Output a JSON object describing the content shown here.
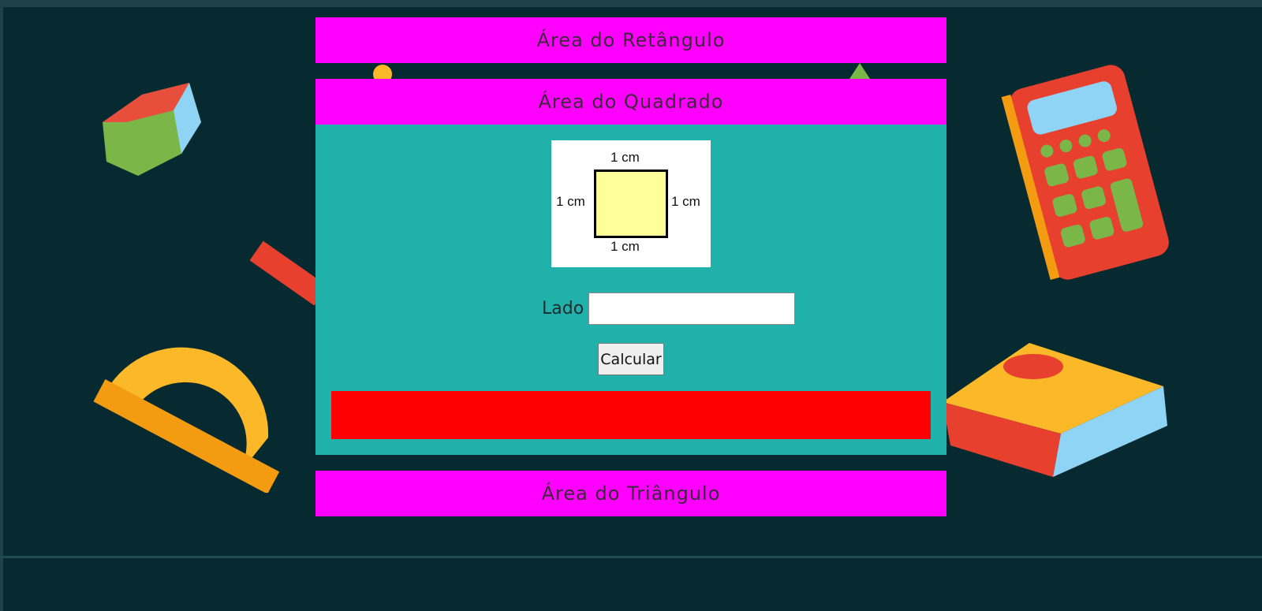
{
  "colors": {
    "background": "#062a30",
    "header_magenta": "#ff00ff",
    "panel_teal": "#20b1aa",
    "result_red": "#ff0000",
    "square_fill": "#ffff99"
  },
  "background_decorations": [
    "cube-icon",
    "calculator-icon",
    "ruler-icon",
    "protractor-icon",
    "book-icon",
    "pencil-icon",
    "set-square-icon"
  ],
  "sections": {
    "rectangle": {
      "title": "Área do Retângulo"
    },
    "square": {
      "title": "Área do Quadrado",
      "figure": {
        "top": "1 cm",
        "left": "1 cm",
        "right": "1 cm",
        "bottom": "1 cm"
      },
      "input_label": "Lado",
      "input_value": "",
      "button_label": "Calcular",
      "result": ""
    },
    "triangle": {
      "title": "Área do Triângulo"
    }
  }
}
